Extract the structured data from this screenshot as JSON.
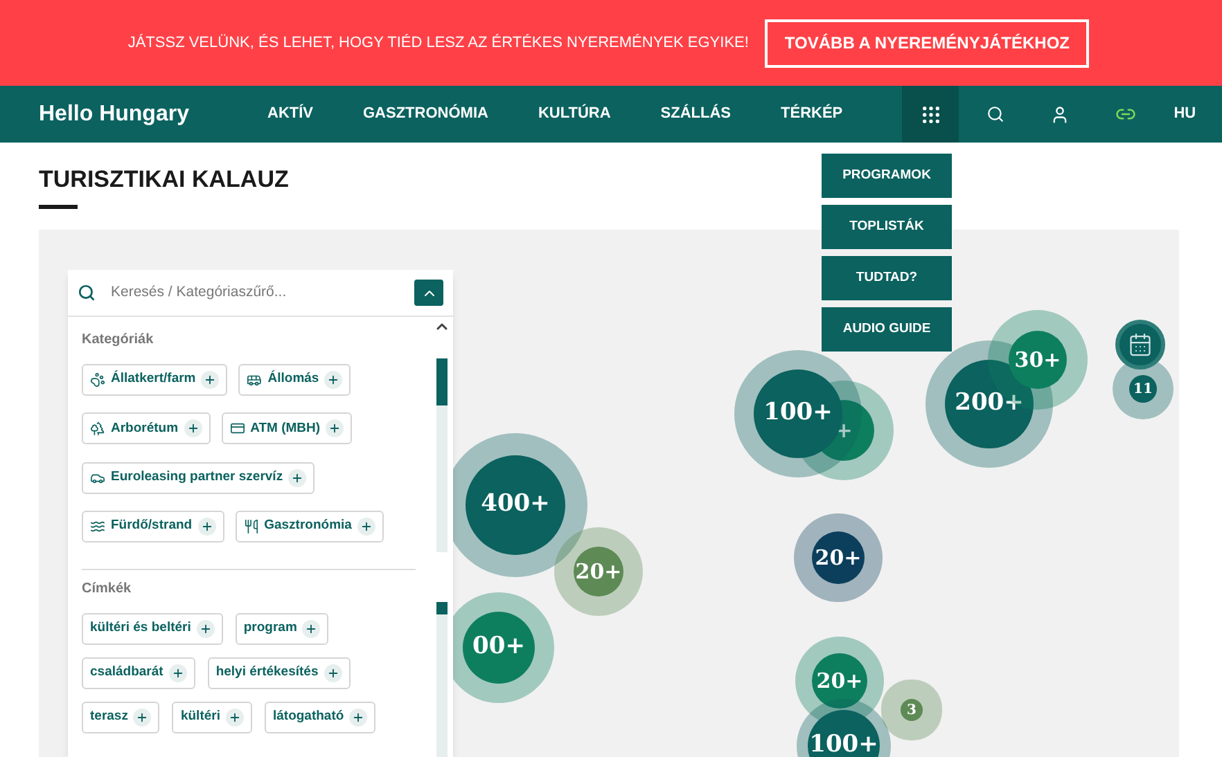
{
  "banner": {
    "text": "JÁTSSZ VELÜNK, ÉS LEHET, HOGY TIÉD LESZ AZ ÉRTÉKES NYEREMÉNYEK EGYIKE!",
    "button": "TOVÁBB A NYEREMÉNYJÁTÉKHOZ"
  },
  "nav": {
    "logo": "Hello Hungary",
    "items": [
      {
        "label": "AKTÍV"
      },
      {
        "label": "GASZTRONÓMIA"
      },
      {
        "label": "KULTÚRA"
      },
      {
        "label": "SZÁLLÁS"
      },
      {
        "label": "TÉRKÉP"
      }
    ],
    "apps_menu_open": true,
    "language": "HU"
  },
  "apps_menu": [
    "PROGRAMOK",
    "TOPLISTÁK",
    "TUDTAD?",
    "AUDIO GUIDE"
  ],
  "page_title": "TURISZTIKAI KALAUZ",
  "filter_panel": {
    "search": {
      "placeholder": "Keresés / Kategóriaszűrő..."
    },
    "categories": {
      "heading": "Kategóriák",
      "chips": [
        {
          "label": "Állatkert/farm"
        },
        {
          "label": "Állomás"
        },
        {
          "label": "Arborétum"
        },
        {
          "label": "ATM (MBH)"
        },
        {
          "label": "Euroleasing partner szervíz"
        },
        {
          "label": "Fürdő/strand"
        },
        {
          "label": "Gasztronómia"
        }
      ]
    },
    "tags": {
      "heading": "Címkék",
      "chips": [
        {
          "label": "kültéri és beltéri"
        },
        {
          "label": "program"
        },
        {
          "label": "családbarát"
        },
        {
          "label": "helyi értékesítés"
        },
        {
          "label": "terasz"
        },
        {
          "label": "kültéri"
        },
        {
          "label": "látogatható"
        }
      ]
    }
  },
  "map_clusters": [
    {
      "label": "400+",
      "color": "#0b625f"
    },
    {
      "label": "+",
      "color": "#0e7f5e"
    },
    {
      "label": "100+",
      "color": "#0b625f"
    },
    {
      "label": "200+",
      "color": "#0b625f"
    },
    {
      "label": "30+",
      "color": "#0e7f5e"
    },
    {
      "label": "11",
      "color": "#0b625f"
    },
    {
      "label": "20+",
      "color": "#5d8a55"
    },
    {
      "label": "20+",
      "color": "#0b3f5c"
    },
    {
      "label": "00+",
      "color": "#0e7f5e"
    },
    {
      "label": "20+",
      "color": "#0e7f5e"
    },
    {
      "label": "3",
      "color": "#5d8a55"
    },
    {
      "label": "100+",
      "color": "#0b625f"
    }
  ]
}
